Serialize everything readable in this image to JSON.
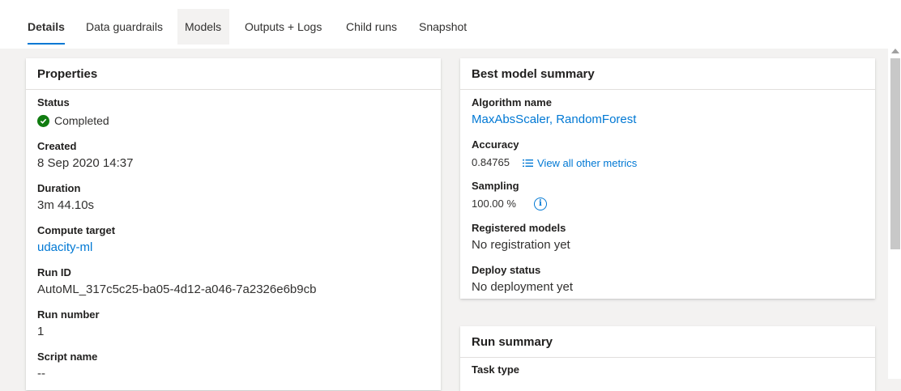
{
  "tabs": [
    {
      "label": "Details"
    },
    {
      "label": "Data guardrails"
    },
    {
      "label": "Models"
    },
    {
      "label": "Outputs + Logs"
    },
    {
      "label": "Child runs"
    },
    {
      "label": "Snapshot"
    }
  ],
  "properties": {
    "title": "Properties",
    "status_label": "Status",
    "status_value": "Completed",
    "status_icon": "check-circle-icon",
    "status_color": "#107c10",
    "created_label": "Created",
    "created_value": "8 Sep 2020 14:37",
    "duration_label": "Duration",
    "duration_value": "3m 44.10s",
    "compute_label": "Compute target",
    "compute_value": "udacity-ml",
    "runid_label": "Run ID",
    "runid_value": "AutoML_317c5c25-ba05-4d12-a046-7a2326e6b9cb",
    "runnumber_label": "Run number",
    "runnumber_value": "1",
    "script_label": "Script name",
    "script_value": "--"
  },
  "best_model": {
    "title": "Best model summary",
    "algorithm_label": "Algorithm name",
    "algorithm_value": "MaxAbsScaler, RandomForest",
    "accuracy_label": "Accuracy",
    "accuracy_value": "0.84765",
    "metrics_link": "View all other metrics",
    "metrics_icon": "list-icon",
    "sampling_label": "Sampling",
    "sampling_value": "100.00 %",
    "sampling_icon": "info-icon",
    "registered_label": "Registered models",
    "registered_value": "No registration yet",
    "deploy_label": "Deploy status",
    "deploy_value": "No deployment yet"
  },
  "run_summary": {
    "title": "Run summary",
    "task_label": "Task type"
  },
  "colors": {
    "accent": "#0078d4",
    "success": "#107c10",
    "background": "#f3f2f1"
  }
}
